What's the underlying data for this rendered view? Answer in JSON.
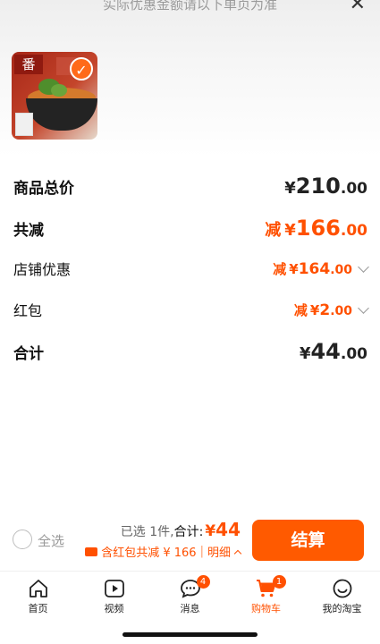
{
  "header": {
    "note": "实际优惠金额请以下单页为准",
    "close_icon": "close-icon"
  },
  "product": {
    "thumb_tag": "番",
    "checked_icon": "check-icon"
  },
  "summary": {
    "goods_total": {
      "label": "商品总价",
      "yen": "¥",
      "int": "210",
      "dec": ".00"
    },
    "total_discount": {
      "label": "共减",
      "prefix": "减",
      "yen": "¥",
      "int": "166",
      "dec": ".00"
    },
    "store_discount": {
      "label": "店铺优惠",
      "prefix": "减",
      "yen": "¥",
      "int": "164",
      "dec": ".00"
    },
    "red_packet": {
      "label": "红包",
      "prefix": "减",
      "yen": "¥",
      "int": "2",
      "dec": ".00"
    },
    "total": {
      "label": "合计",
      "yen": "¥",
      "int": "44",
      "dec": ".00"
    }
  },
  "checkout": {
    "select_all": "全选",
    "selected_count": "已选 1件,",
    "total_label": "合计:",
    "total_yen": "¥",
    "total_value": "44",
    "promo_text": "含红包共减 ¥ 166",
    "detail": "明细",
    "settle_button": "结算"
  },
  "tabbar": {
    "items": [
      {
        "label": "首页",
        "icon": "home-icon"
      },
      {
        "label": "视频",
        "icon": "video-icon"
      },
      {
        "label": "消息",
        "icon": "message-icon",
        "badge": "4"
      },
      {
        "label": "购物车",
        "icon": "cart-icon",
        "badge": "1",
        "active": true
      },
      {
        "label": "我的淘宝",
        "icon": "profile-icon"
      }
    ]
  },
  "colors": {
    "accent": "#ff5000",
    "button": "#ff5a00"
  }
}
